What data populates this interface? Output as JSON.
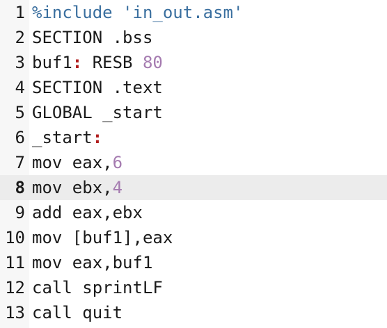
{
  "editor": {
    "current_line": 8,
    "lines": [
      {
        "num": "1",
        "tokens": [
          {
            "t": "pp",
            "v": "%include 'in_out.asm'"
          }
        ]
      },
      {
        "num": "2",
        "tokens": [
          {
            "t": "text",
            "v": "SECTION .bss"
          }
        ]
      },
      {
        "num": "3",
        "tokens": [
          {
            "t": "text",
            "v": "buf1"
          },
          {
            "t": "colon",
            "v": ":"
          },
          {
            "t": "text",
            "v": " RESB "
          },
          {
            "t": "num",
            "v": "80"
          }
        ]
      },
      {
        "num": "4",
        "tokens": [
          {
            "t": "text",
            "v": "SECTION .text"
          }
        ]
      },
      {
        "num": "5",
        "tokens": [
          {
            "t": "text",
            "v": "GLOBAL _start"
          }
        ]
      },
      {
        "num": "6",
        "tokens": [
          {
            "t": "text",
            "v": "_start"
          },
          {
            "t": "colon",
            "v": ":"
          }
        ]
      },
      {
        "num": "7",
        "tokens": [
          {
            "t": "text",
            "v": "mov eax,"
          },
          {
            "t": "num",
            "v": "6"
          }
        ]
      },
      {
        "num": "8",
        "tokens": [
          {
            "t": "text",
            "v": "mov ebx,"
          },
          {
            "t": "num",
            "v": "4"
          }
        ]
      },
      {
        "num": "9",
        "tokens": [
          {
            "t": "text",
            "v": "add eax,ebx"
          }
        ]
      },
      {
        "num": "10",
        "tokens": [
          {
            "t": "text",
            "v": "mov [buf1],eax"
          }
        ]
      },
      {
        "num": "11",
        "tokens": [
          {
            "t": "text",
            "v": "mov eax,buf1"
          }
        ]
      },
      {
        "num": "12",
        "tokens": [
          {
            "t": "text",
            "v": "call sprintLF"
          }
        ]
      },
      {
        "num": "13",
        "tokens": [
          {
            "t": "text",
            "v": "call quit"
          }
        ]
      }
    ]
  },
  "colors": {
    "preprocessor": "#3a6f9f",
    "number": "#a57bb0",
    "colon": "#b01c1c",
    "text": "#1a1a1a",
    "current_line_bg": "#ececec"
  }
}
